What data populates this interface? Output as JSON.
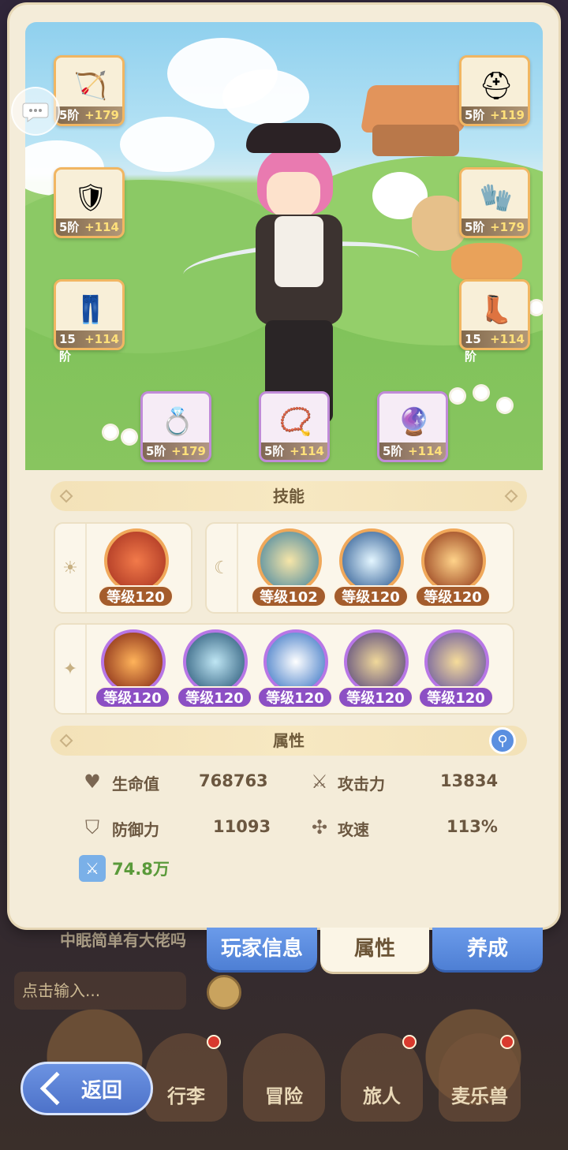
{
  "equipment": {
    "bow": {
      "tier": "5阶",
      "plus": "+179"
    },
    "helmet": {
      "tier": "5阶",
      "plus": "+119"
    },
    "armor": {
      "tier": "5阶",
      "plus": "+114"
    },
    "bracer": {
      "tier": "5阶",
      "plus": "+179"
    },
    "pants": {
      "tier": "15阶",
      "plus": "+114"
    },
    "boots": {
      "tier": "15阶",
      "plus": "+114"
    },
    "ring": {
      "tier": "5阶",
      "plus": "+179"
    },
    "necklace": {
      "tier": "5阶",
      "plus": "+114"
    },
    "charm": {
      "tier": "5阶",
      "plus": "+114"
    }
  },
  "skills": {
    "header": "技能",
    "row1_left": [
      {
        "level": "等级120"
      }
    ],
    "row1_right": [
      {
        "level": "等级102"
      },
      {
        "level": "等级120"
      },
      {
        "level": "等级120"
      }
    ],
    "row2": [
      {
        "level": "等级120"
      },
      {
        "level": "等级120"
      },
      {
        "level": "等级120"
      },
      {
        "level": "等级120"
      },
      {
        "level": "等级120"
      }
    ]
  },
  "attributes": {
    "header": "属性",
    "hp_label": "生命值",
    "hp_value": "768763",
    "atk_label": "攻击力",
    "atk_value": "13834",
    "def_label": "防御力",
    "def_value": "11093",
    "spd_label": "攻速",
    "spd_value": "113%",
    "power_value": "74.8万"
  },
  "tabs": {
    "player_info": "玩家信息",
    "attributes": "属性",
    "cultivate": "养成"
  },
  "background": {
    "chat_text": "中眠简单有大佬吗",
    "chat_placeholder": "点击输入...",
    "nav": [
      "行李",
      "冒险",
      "旅人",
      "麦乐兽"
    ]
  },
  "back_button": "返回",
  "colors": {
    "accent_blue": "#5a8fe0",
    "tier_orange": "#f1b662",
    "tier_purple": "#c08bd8",
    "power_green": "#5a9a3a"
  }
}
